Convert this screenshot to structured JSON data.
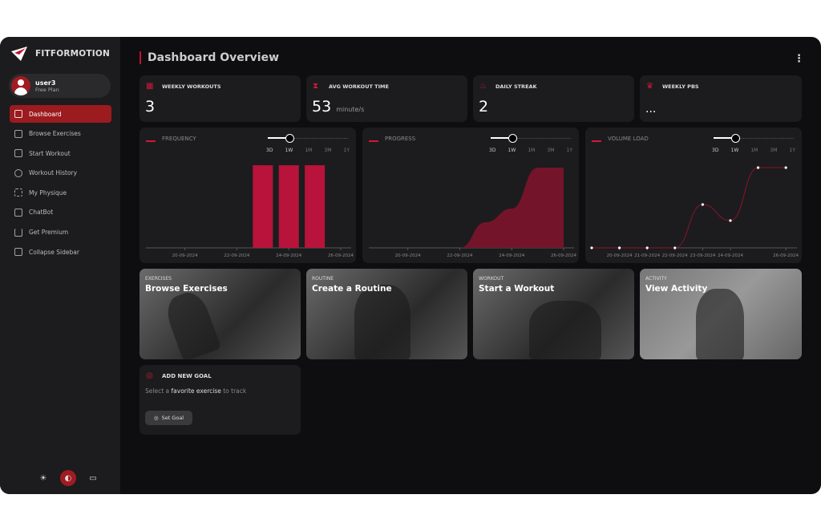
{
  "app": {
    "name": "FITFORMOTION"
  },
  "user": {
    "name": "user3",
    "plan": "Free Plan"
  },
  "sidebar": {
    "items": [
      {
        "label": "Dashboard",
        "icon": "grid-icon",
        "active": true
      },
      {
        "label": "Browse Exercises",
        "icon": "list-search-icon"
      },
      {
        "label": "Start Workout",
        "icon": "dumbbell-icon"
      },
      {
        "label": "Workout History",
        "icon": "history-icon"
      },
      {
        "label": "My Physique",
        "icon": "body-scan-icon"
      },
      {
        "label": "ChatBot",
        "icon": "chat-icon"
      },
      {
        "label": "Get Premium",
        "icon": "crown-icon"
      },
      {
        "label": "Collapse Sidebar",
        "icon": "sidebar-collapse-icon"
      }
    ]
  },
  "theme": {
    "options": [
      "light",
      "dark",
      "system"
    ],
    "selected": "dark"
  },
  "header": {
    "title": "Dashboard Overview"
  },
  "stats": [
    {
      "label": "WEEKLY WORKOUTS",
      "value": "3",
      "unit": "",
      "icon": "calendar-icon"
    },
    {
      "label": "AVG WORKOUT TIME",
      "value": "53",
      "unit": "minute/s",
      "icon": "hourglass-icon"
    },
    {
      "label": "DAILY STREAK",
      "value": "2",
      "unit": "",
      "icon": "flame-icon"
    },
    {
      "label": "WEEKLY PBS",
      "value": "...",
      "unit": "",
      "icon": "trophy-icon"
    }
  ],
  "range_options": [
    "3D",
    "1W",
    "1M",
    "3M",
    "1Y"
  ],
  "range_selected": "1W",
  "accent": "#c0132f",
  "chart_data": [
    {
      "type": "bar",
      "title": "FREQUENCY",
      "x": [
        "23-09-2024",
        "24-09-2024",
        "25-09-2024"
      ],
      "values": [
        1,
        1,
        1
      ],
      "xticks": [
        "20-09-2024",
        "22-09-2024",
        "24-09-2024",
        "26-09-2024"
      ]
    },
    {
      "type": "area",
      "title": "PROGRESS",
      "x": [
        "22-09-2024",
        "23-09-2024",
        "24-09-2024",
        "25-09-2024",
        "26-09-2024"
      ],
      "values": [
        0,
        0.32,
        0.49,
        1,
        1
      ],
      "xticks": [
        "20-09-2024",
        "22-09-2024",
        "24-09-2024",
        "26-09-2024"
      ]
    },
    {
      "type": "line",
      "title": "VOLUME LOAD",
      "x": [
        "19-09-2024",
        "20-09-2024",
        "21-09-2024",
        "22-09-2024",
        "23-09-2024",
        "24-09-2024",
        "25-09-2024",
        "26-09-2024"
      ],
      "values": [
        0,
        0,
        0,
        0,
        0.54,
        0.34,
        1,
        1
      ],
      "xticks": [
        "20-09-2024",
        "21-09-2024",
        "22-09-2024",
        "23-09-2024",
        "24-09-2024",
        "26-09-2024"
      ]
    }
  ],
  "tiles": [
    {
      "kicker": "EXERCISES",
      "title": "Browse Exercises"
    },
    {
      "kicker": "ROUTINE",
      "title": "Create a Routine"
    },
    {
      "kicker": "WORKOUT",
      "title": "Start a Workout"
    },
    {
      "kicker": "ACTIVITY",
      "title": "View Activity"
    }
  ],
  "goal": {
    "title": "ADD NEW GOAL",
    "text_pre": "Select a ",
    "text_em": "favorite exercise",
    "text_post": " to track",
    "button": "Set Goal"
  }
}
